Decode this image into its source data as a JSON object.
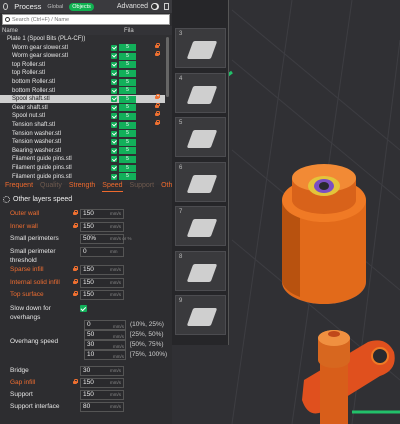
{
  "header": {
    "title": "Process",
    "global_label": "Global",
    "objects_label": "Objects",
    "advanced_label": "Advanced"
  },
  "search": {
    "placeholder": "Search (Ctrl+F) / Name"
  },
  "list": {
    "col_name": "Name",
    "col_fila": "Fila",
    "items": [
      {
        "name": "Plate 1 (Spool Bits (PLA-CF))",
        "top": true,
        "filament": "",
        "lock": false,
        "selected": false
      },
      {
        "name": "Worm gear slower.stl",
        "filament": "5",
        "lock": true,
        "selected": false
      },
      {
        "name": "Worm gear slower.stl",
        "filament": "5",
        "lock": true,
        "selected": false
      },
      {
        "name": "top Roller.stl",
        "filament": "5",
        "lock": false,
        "selected": false
      },
      {
        "name": "top Roller.stl",
        "filament": "5",
        "lock": false,
        "selected": false
      },
      {
        "name": "bottom Roller.stl",
        "filament": "5",
        "lock": false,
        "selected": false
      },
      {
        "name": "bottom Roller.stl",
        "filament": "5",
        "lock": false,
        "selected": false
      },
      {
        "name": "Spool shaft.stl",
        "filament": "5",
        "lock": true,
        "selected": true
      },
      {
        "name": "Gear shaft.stl",
        "filament": "5",
        "lock": true,
        "selected": false
      },
      {
        "name": "Spool nut.stl",
        "filament": "5",
        "lock": true,
        "selected": false
      },
      {
        "name": "Tension shaft.stl",
        "filament": "5",
        "lock": true,
        "selected": false
      },
      {
        "name": "Tension washer.stl",
        "filament": "5",
        "lock": false,
        "selected": false
      },
      {
        "name": "Tension washer.stl",
        "filament": "5",
        "lock": false,
        "selected": false
      },
      {
        "name": "Bearing washer.stl",
        "filament": "5",
        "lock": false,
        "selected": false
      },
      {
        "name": "Filament guide pins.stl",
        "filament": "5",
        "lock": false,
        "selected": false
      },
      {
        "name": "Filament guide pins.stl",
        "filament": "5",
        "lock": false,
        "selected": false
      },
      {
        "name": "Filament guide pins.stl",
        "filament": "5",
        "lock": false,
        "selected": false
      }
    ]
  },
  "tabs": [
    {
      "label": "Frequent",
      "state": "normal"
    },
    {
      "label": "Quality",
      "state": "dim"
    },
    {
      "label": "Strength",
      "state": "normal"
    },
    {
      "label": "Speed",
      "state": "active"
    },
    {
      "label": "Support",
      "state": "dim"
    },
    {
      "label": "Others",
      "state": "normal"
    }
  ],
  "section_title": "Other layers speed",
  "params": [
    {
      "label": "Outer wall",
      "value": "150",
      "unit": "mm/s",
      "modified": true,
      "lock": true
    },
    {
      "label": "Inner wall",
      "value": "150",
      "unit": "mm/s",
      "modified": true,
      "lock": true
    },
    {
      "label": "Small perimeters",
      "value": "50%",
      "unit": "mm/s or %",
      "modified": false,
      "lock": false
    },
    {
      "label": "Small perimeter",
      "label2": "threshold",
      "value": "0",
      "unit": "mm",
      "modified": false,
      "lock": false
    },
    {
      "label": "Sparse infill",
      "value": "150",
      "unit": "mm/s",
      "modified": true,
      "lock": true
    },
    {
      "label": "Internal solid infill",
      "value": "150",
      "unit": "mm/s",
      "modified": true,
      "lock": true
    },
    {
      "label": "Top surface",
      "value": "150",
      "unit": "mm/s",
      "modified": true,
      "lock": true
    },
    {
      "label": "Slow down for",
      "label2": "overhangs",
      "checkbox": true
    }
  ],
  "overhang": {
    "label": "Overhang speed",
    "rows": [
      {
        "value": "0",
        "range": "(10%, 25%)"
      },
      {
        "value": "50",
        "range": "[25%, 50%)"
      },
      {
        "value": "30",
        "range": "[50%, 75%)"
      },
      {
        "value": "10",
        "range": "[75%, 100%)"
      }
    ],
    "unit": "mm/s"
  },
  "params2": [
    {
      "label": "Bridge",
      "value": "30",
      "unit": "mm/s",
      "modified": false,
      "lock": false
    },
    {
      "label": "Gap infill",
      "value": "150",
      "unit": "mm/s",
      "modified": true,
      "lock": true
    },
    {
      "label": "Support",
      "value": "150",
      "unit": "mm/s",
      "modified": false,
      "lock": false
    },
    {
      "label": "Support interface",
      "value": "80",
      "unit": "mm/s",
      "modified": false,
      "lock": false
    }
  ],
  "plates": [
    "3",
    "4",
    "5",
    "6",
    "7",
    "8",
    "9"
  ],
  "colors": {
    "accent": "#ef6d30",
    "green": "#12b05a",
    "model_orange": "#e26a1a",
    "model_blue": "#1f4e9a"
  }
}
